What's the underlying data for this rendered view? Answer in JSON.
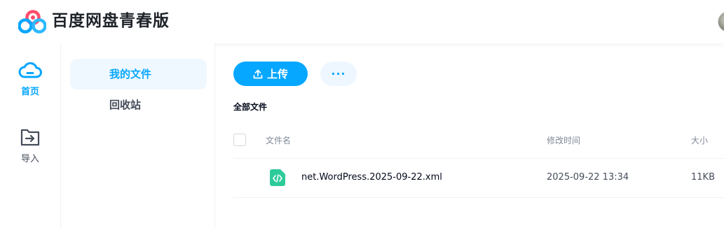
{
  "app": {
    "title": "百度网盘青春版"
  },
  "rail": [
    {
      "label": "首页",
      "icon": "cloud-icon",
      "active": true
    },
    {
      "label": "导入",
      "icon": "import-icon",
      "active": false
    }
  ],
  "sidebar": {
    "items": [
      {
        "label": "我的文件",
        "active": true
      },
      {
        "label": "回收站",
        "active": false
      }
    ]
  },
  "toolbar": {
    "upload_label": "上传",
    "more_label": "···"
  },
  "breadcrumb": "全部文件",
  "table": {
    "columns": {
      "name": "文件名",
      "modified": "修改时间",
      "size": "大小"
    },
    "rows": [
      {
        "icon": "code-file-icon",
        "name": "net.WordPress.2025-09-22.xml",
        "modified": "2025-09-22 13:34",
        "size": "11KB"
      }
    ]
  },
  "colors": {
    "accent": "#06a7ff",
    "file_icon": "#2ecb9a"
  }
}
